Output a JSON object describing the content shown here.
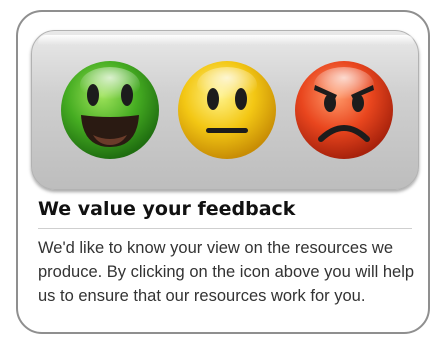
{
  "feedback": {
    "heading": "We value your feedback",
    "body": "We'd like to know your view on the resources we produce. By clicking on the icon above you will help us to ensure that our resources work for you."
  },
  "faces": [
    {
      "icon": "happy-face-icon",
      "color": "#3faa25"
    },
    {
      "icon": "neutral-face-icon",
      "color": "#f0c20c"
    },
    {
      "icon": "angry-face-icon",
      "color": "#e5401b"
    }
  ]
}
